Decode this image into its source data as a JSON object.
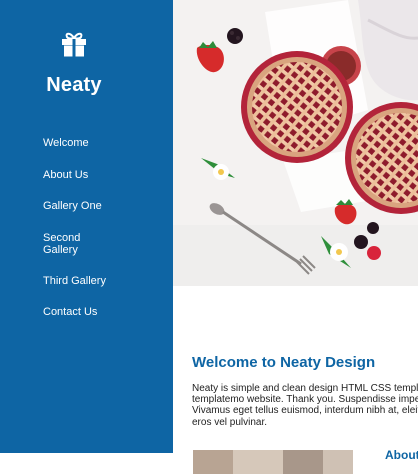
{
  "sidebar": {
    "logo_icon": "gift-icon",
    "brand": "Neaty",
    "nav": [
      {
        "label": "Welcome"
      },
      {
        "label": "About Us"
      },
      {
        "label": "Gallery One"
      },
      {
        "label": "Second Gallery"
      },
      {
        "label": "Third Gallery"
      },
      {
        "label": "Contact Us"
      }
    ]
  },
  "hero": {
    "image": "pies-on-table-photo"
  },
  "welcome": {
    "title": "Welcome to Neaty Design",
    "lines": [
      "Neaty is simple and clean design HTML CSS templa",
      "templatemo website. Thank you. Suspendisse impe",
      "Vivamus eget tellus euismod, interdum nibh at, eleif",
      "eros vel pulvinar."
    ]
  },
  "about": {
    "heading": "About"
  },
  "colors": {
    "primary": "#0e65a4",
    "text": "#222222",
    "background": "#ffffff"
  }
}
